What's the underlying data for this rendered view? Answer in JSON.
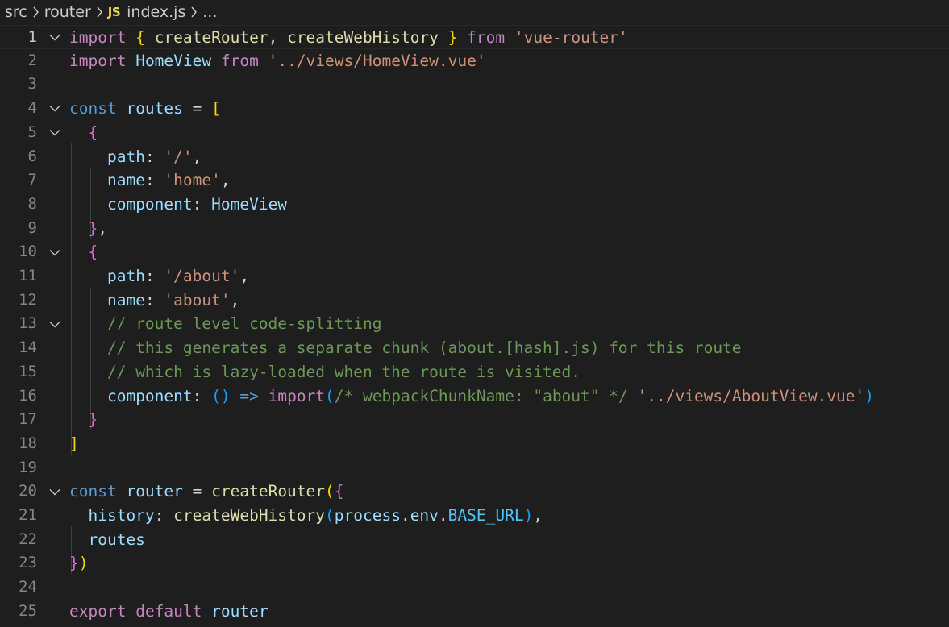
{
  "breadcrumb": {
    "items": [
      "src",
      "router",
      "index.js",
      "..."
    ],
    "file_badge": "JS"
  },
  "editor": {
    "language": "javascript",
    "current_line": 1,
    "lines": [
      {
        "n": "1",
        "fold": true,
        "tokens": [
          [
            "kw2",
            "import"
          ],
          [
            "op",
            " "
          ],
          [
            "b1",
            "{"
          ],
          [
            "op",
            " "
          ],
          [
            "fn",
            "createRouter"
          ],
          [
            "op",
            ", "
          ],
          [
            "fn",
            "createWebHistory"
          ],
          [
            "op",
            " "
          ],
          [
            "b1",
            "}"
          ],
          [
            "op",
            " "
          ],
          [
            "kw2",
            "from"
          ],
          [
            "op",
            " "
          ],
          [
            "str",
            "'vue-router'"
          ]
        ]
      },
      {
        "n": "2",
        "fold": false,
        "tokens": [
          [
            "kw2",
            "import"
          ],
          [
            "op",
            " "
          ],
          [
            "var",
            "HomeView"
          ],
          [
            "op",
            " "
          ],
          [
            "kw2",
            "from"
          ],
          [
            "op",
            " "
          ],
          [
            "str",
            "'../views/HomeView.vue'"
          ]
        ]
      },
      {
        "n": "3",
        "fold": false,
        "tokens": []
      },
      {
        "n": "4",
        "fold": true,
        "tokens": [
          [
            "kw",
            "const"
          ],
          [
            "op",
            " "
          ],
          [
            "var",
            "routes"
          ],
          [
            "op",
            " = "
          ],
          [
            "b1",
            "["
          ]
        ]
      },
      {
        "n": "5",
        "fold": true,
        "tokens": [
          [
            "op",
            "  "
          ],
          [
            "b2",
            "{"
          ]
        ]
      },
      {
        "n": "6",
        "fold": false,
        "tokens": [
          [
            "op",
            "    "
          ],
          [
            "var",
            "path"
          ],
          [
            "op",
            ": "
          ],
          [
            "str",
            "'/'"
          ],
          [
            "op",
            ","
          ]
        ]
      },
      {
        "n": "7",
        "fold": false,
        "tokens": [
          [
            "op",
            "    "
          ],
          [
            "var",
            "name"
          ],
          [
            "op",
            ": "
          ],
          [
            "str",
            "'home'"
          ],
          [
            "op",
            ","
          ]
        ]
      },
      {
        "n": "8",
        "fold": false,
        "tokens": [
          [
            "op",
            "    "
          ],
          [
            "var",
            "component"
          ],
          [
            "op",
            ": "
          ],
          [
            "var",
            "HomeView"
          ]
        ]
      },
      {
        "n": "9",
        "fold": false,
        "tokens": [
          [
            "op",
            "  "
          ],
          [
            "b2",
            "}"
          ],
          [
            "op",
            ","
          ]
        ]
      },
      {
        "n": "10",
        "fold": true,
        "tokens": [
          [
            "op",
            "  "
          ],
          [
            "b2",
            "{"
          ]
        ]
      },
      {
        "n": "11",
        "fold": false,
        "tokens": [
          [
            "op",
            "    "
          ],
          [
            "var",
            "path"
          ],
          [
            "op",
            ": "
          ],
          [
            "str",
            "'/about'"
          ],
          [
            "op",
            ","
          ]
        ]
      },
      {
        "n": "12",
        "fold": false,
        "tokens": [
          [
            "op",
            "    "
          ],
          [
            "var",
            "name"
          ],
          [
            "op",
            ": "
          ],
          [
            "str",
            "'about'"
          ],
          [
            "op",
            ","
          ]
        ]
      },
      {
        "n": "13",
        "fold": true,
        "tokens": [
          [
            "op",
            "    "
          ],
          [
            "cm",
            "// route level code-splitting"
          ]
        ]
      },
      {
        "n": "14",
        "fold": false,
        "tokens": [
          [
            "op",
            "    "
          ],
          [
            "cm",
            "// this generates a separate chunk (about.[hash].js) for this route"
          ]
        ]
      },
      {
        "n": "15",
        "fold": false,
        "tokens": [
          [
            "op",
            "    "
          ],
          [
            "cm",
            "// which is lazy-loaded when the route is visited."
          ]
        ]
      },
      {
        "n": "16",
        "fold": false,
        "tokens": [
          [
            "op",
            "    "
          ],
          [
            "var",
            "component"
          ],
          [
            "op",
            ": "
          ],
          [
            "b3",
            "()"
          ],
          [
            "op",
            " "
          ],
          [
            "kw",
            "=>"
          ],
          [
            "op",
            " "
          ],
          [
            "kw2",
            "import"
          ],
          [
            "b3",
            "("
          ],
          [
            "cm",
            "/* webpackChunkName: \"about\" */"
          ],
          [
            "op",
            " "
          ],
          [
            "str",
            "'../views/AboutView.vue'"
          ],
          [
            "b3",
            ")"
          ]
        ]
      },
      {
        "n": "17",
        "fold": false,
        "tokens": [
          [
            "op",
            "  "
          ],
          [
            "b2",
            "}"
          ]
        ]
      },
      {
        "n": "18",
        "fold": false,
        "tokens": [
          [
            "b1",
            "]"
          ]
        ]
      },
      {
        "n": "19",
        "fold": false,
        "tokens": []
      },
      {
        "n": "20",
        "fold": true,
        "tokens": [
          [
            "kw",
            "const"
          ],
          [
            "op",
            " "
          ],
          [
            "var",
            "router"
          ],
          [
            "op",
            " = "
          ],
          [
            "fn",
            "createRouter"
          ],
          [
            "b1",
            "("
          ],
          [
            "b2",
            "{"
          ]
        ]
      },
      {
        "n": "21",
        "fold": false,
        "tokens": [
          [
            "op",
            "  "
          ],
          [
            "var",
            "history"
          ],
          [
            "op",
            ": "
          ],
          [
            "fn",
            "createWebHistory"
          ],
          [
            "b3",
            "("
          ],
          [
            "var",
            "process"
          ],
          [
            "op",
            "."
          ],
          [
            "var",
            "env"
          ],
          [
            "op",
            "."
          ],
          [
            "const",
            "BASE_URL"
          ],
          [
            "b3",
            ")"
          ],
          [
            "op",
            ","
          ]
        ]
      },
      {
        "n": "22",
        "fold": false,
        "tokens": [
          [
            "op",
            "  "
          ],
          [
            "var",
            "routes"
          ]
        ]
      },
      {
        "n": "23",
        "fold": false,
        "tokens": [
          [
            "b2",
            "}"
          ],
          [
            "b1",
            ")"
          ]
        ]
      },
      {
        "n": "24",
        "fold": false,
        "tokens": []
      },
      {
        "n": "25",
        "fold": false,
        "tokens": [
          [
            "kw2",
            "export"
          ],
          [
            "op",
            " "
          ],
          [
            "kw2",
            "default"
          ],
          [
            "op",
            " "
          ],
          [
            "var",
            "router"
          ]
        ]
      }
    ]
  }
}
